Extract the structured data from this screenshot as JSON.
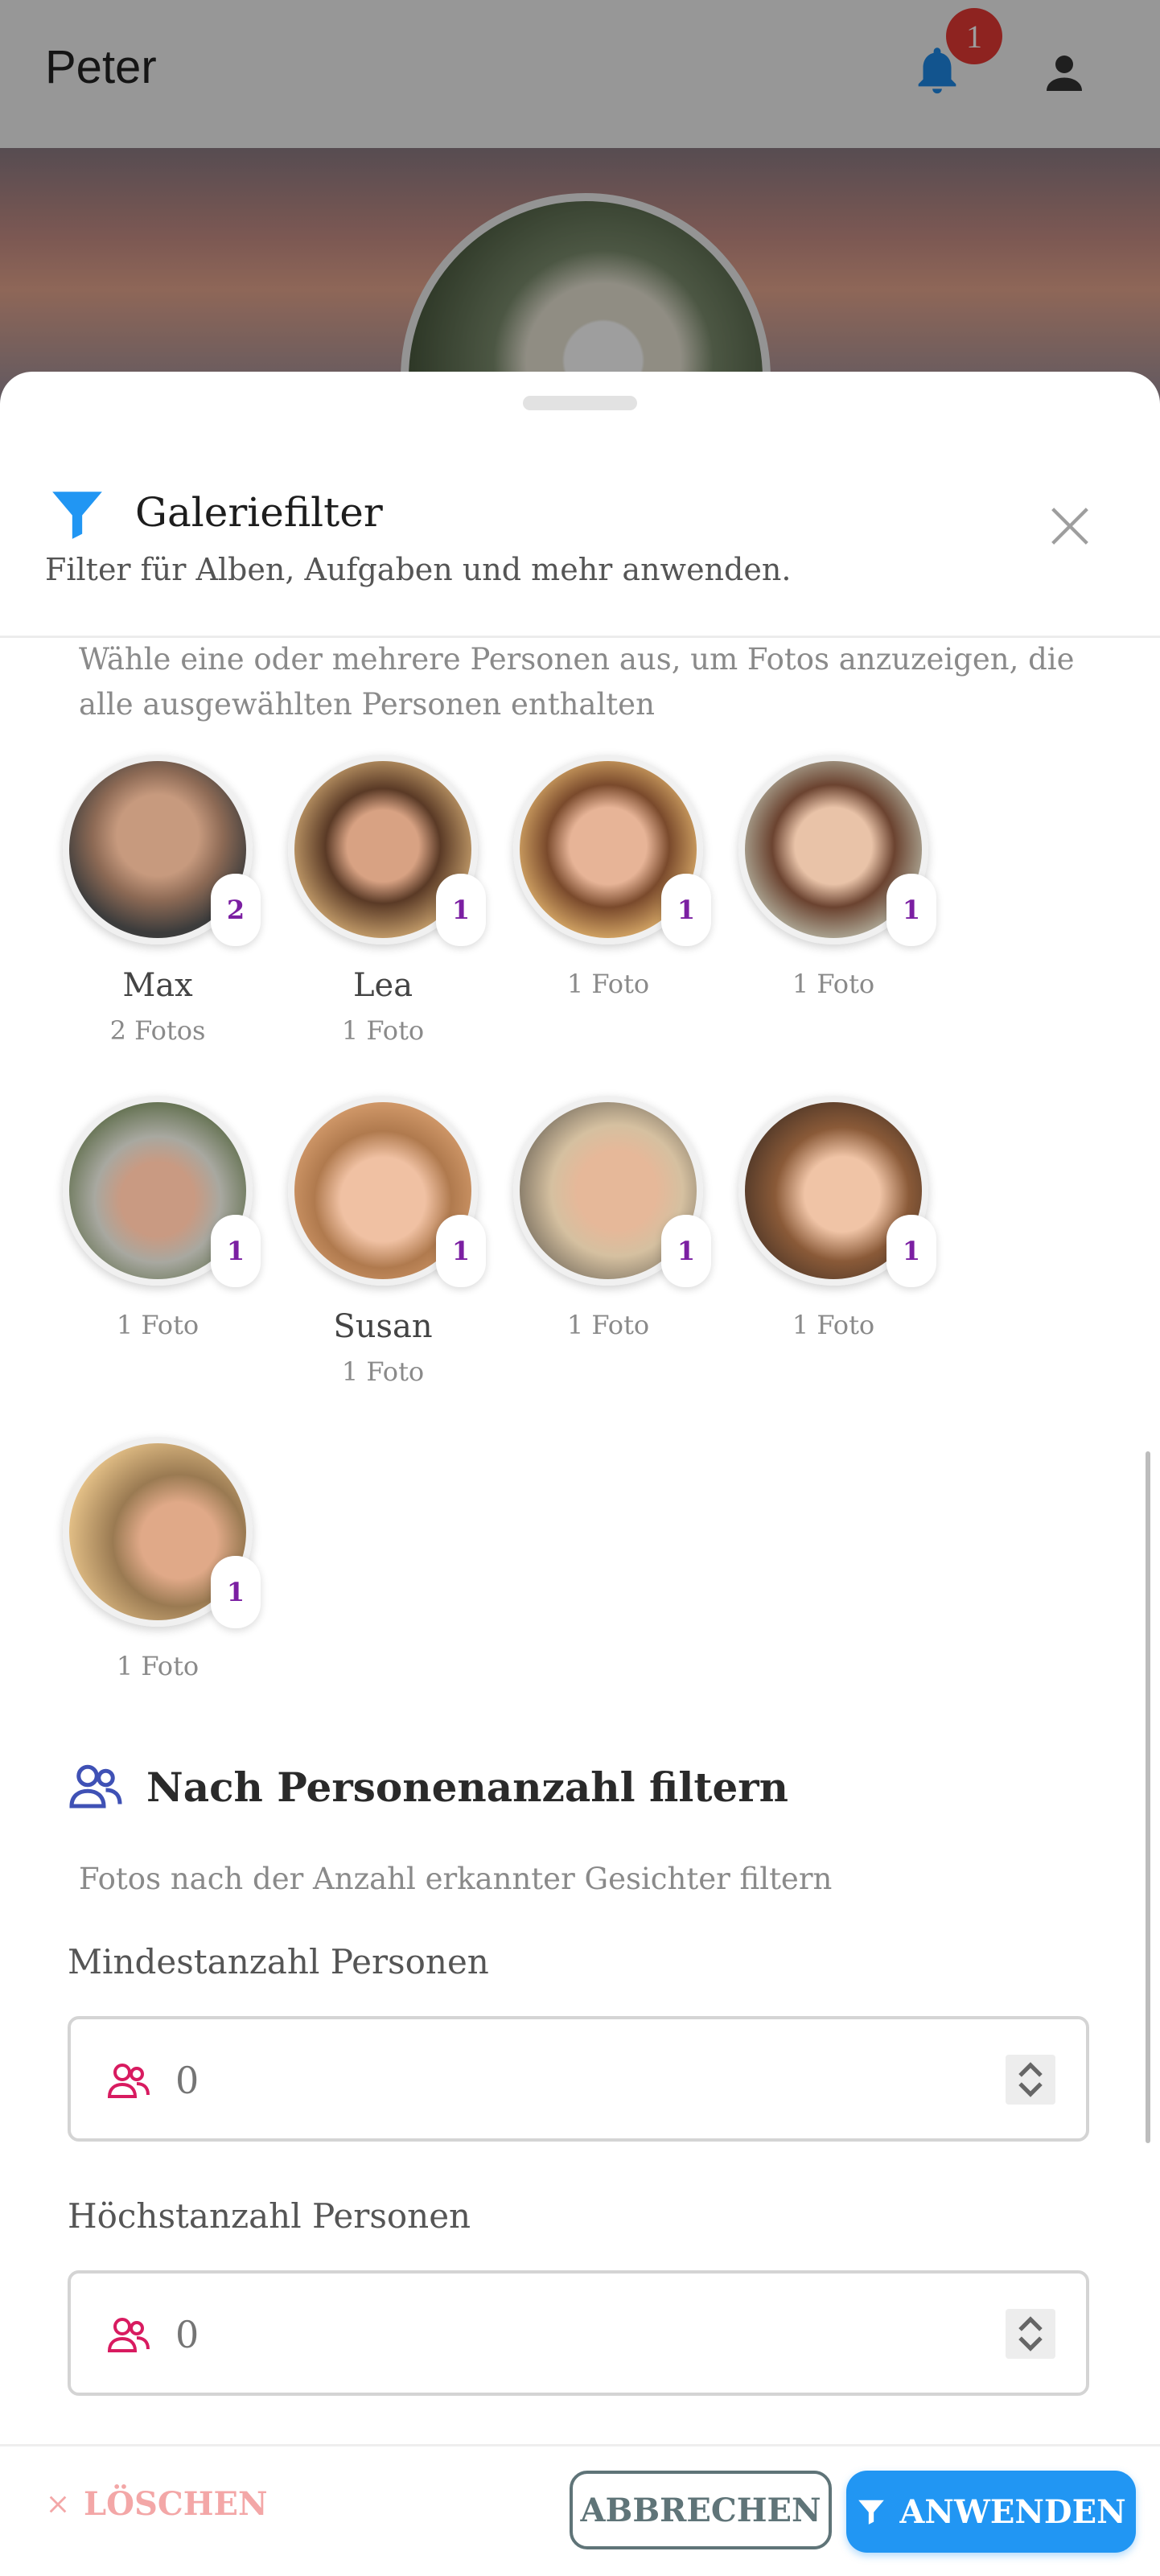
{
  "appbar": {
    "title": "Peter",
    "notification_count": "1"
  },
  "sheet": {
    "title": "Galeriefilter",
    "subtitle": "Filter für Alben, Aufgaben und mehr anwenden.",
    "intro": "Wähle eine oder mehrere Personen aus, um Fotos anzuzeigen, die alle ausgewählten Personen enthalten"
  },
  "people": [
    {
      "name": "Max",
      "count_badge": "2",
      "photos": "2 Fotos"
    },
    {
      "name": "Lea",
      "count_badge": "1",
      "photos": "1 Foto"
    },
    {
      "name": "",
      "count_badge": "1",
      "photos": "1 Foto"
    },
    {
      "name": "",
      "count_badge": "1",
      "photos": "1 Foto"
    },
    {
      "name": "",
      "count_badge": "1",
      "photos": "1 Foto"
    },
    {
      "name": "Susan",
      "count_badge": "1",
      "photos": "1 Foto"
    },
    {
      "name": "",
      "count_badge": "1",
      "photos": "1 Foto"
    },
    {
      "name": "",
      "count_badge": "1",
      "photos": "1 Foto"
    },
    {
      "name": "",
      "count_badge": "1",
      "photos": "1 Foto"
    }
  ],
  "count_filter": {
    "title": "Nach Personenanzahl filtern",
    "subtitle": "Fotos nach der Anzahl erkannter Gesichter filtern",
    "min_label": "Mindestanzahl Personen",
    "min_placeholder": "0",
    "max_label": "Höchstanzahl Personen",
    "max_placeholder": "0"
  },
  "footer": {
    "clear": "LÖSCHEN",
    "cancel": "ABBRECHEN",
    "apply": "ANWENDEN"
  },
  "colors": {
    "accent": "#2196f3",
    "badge_text": "#7b1fa2",
    "danger_light": "#f3a7a7",
    "notification": "#e53935"
  }
}
